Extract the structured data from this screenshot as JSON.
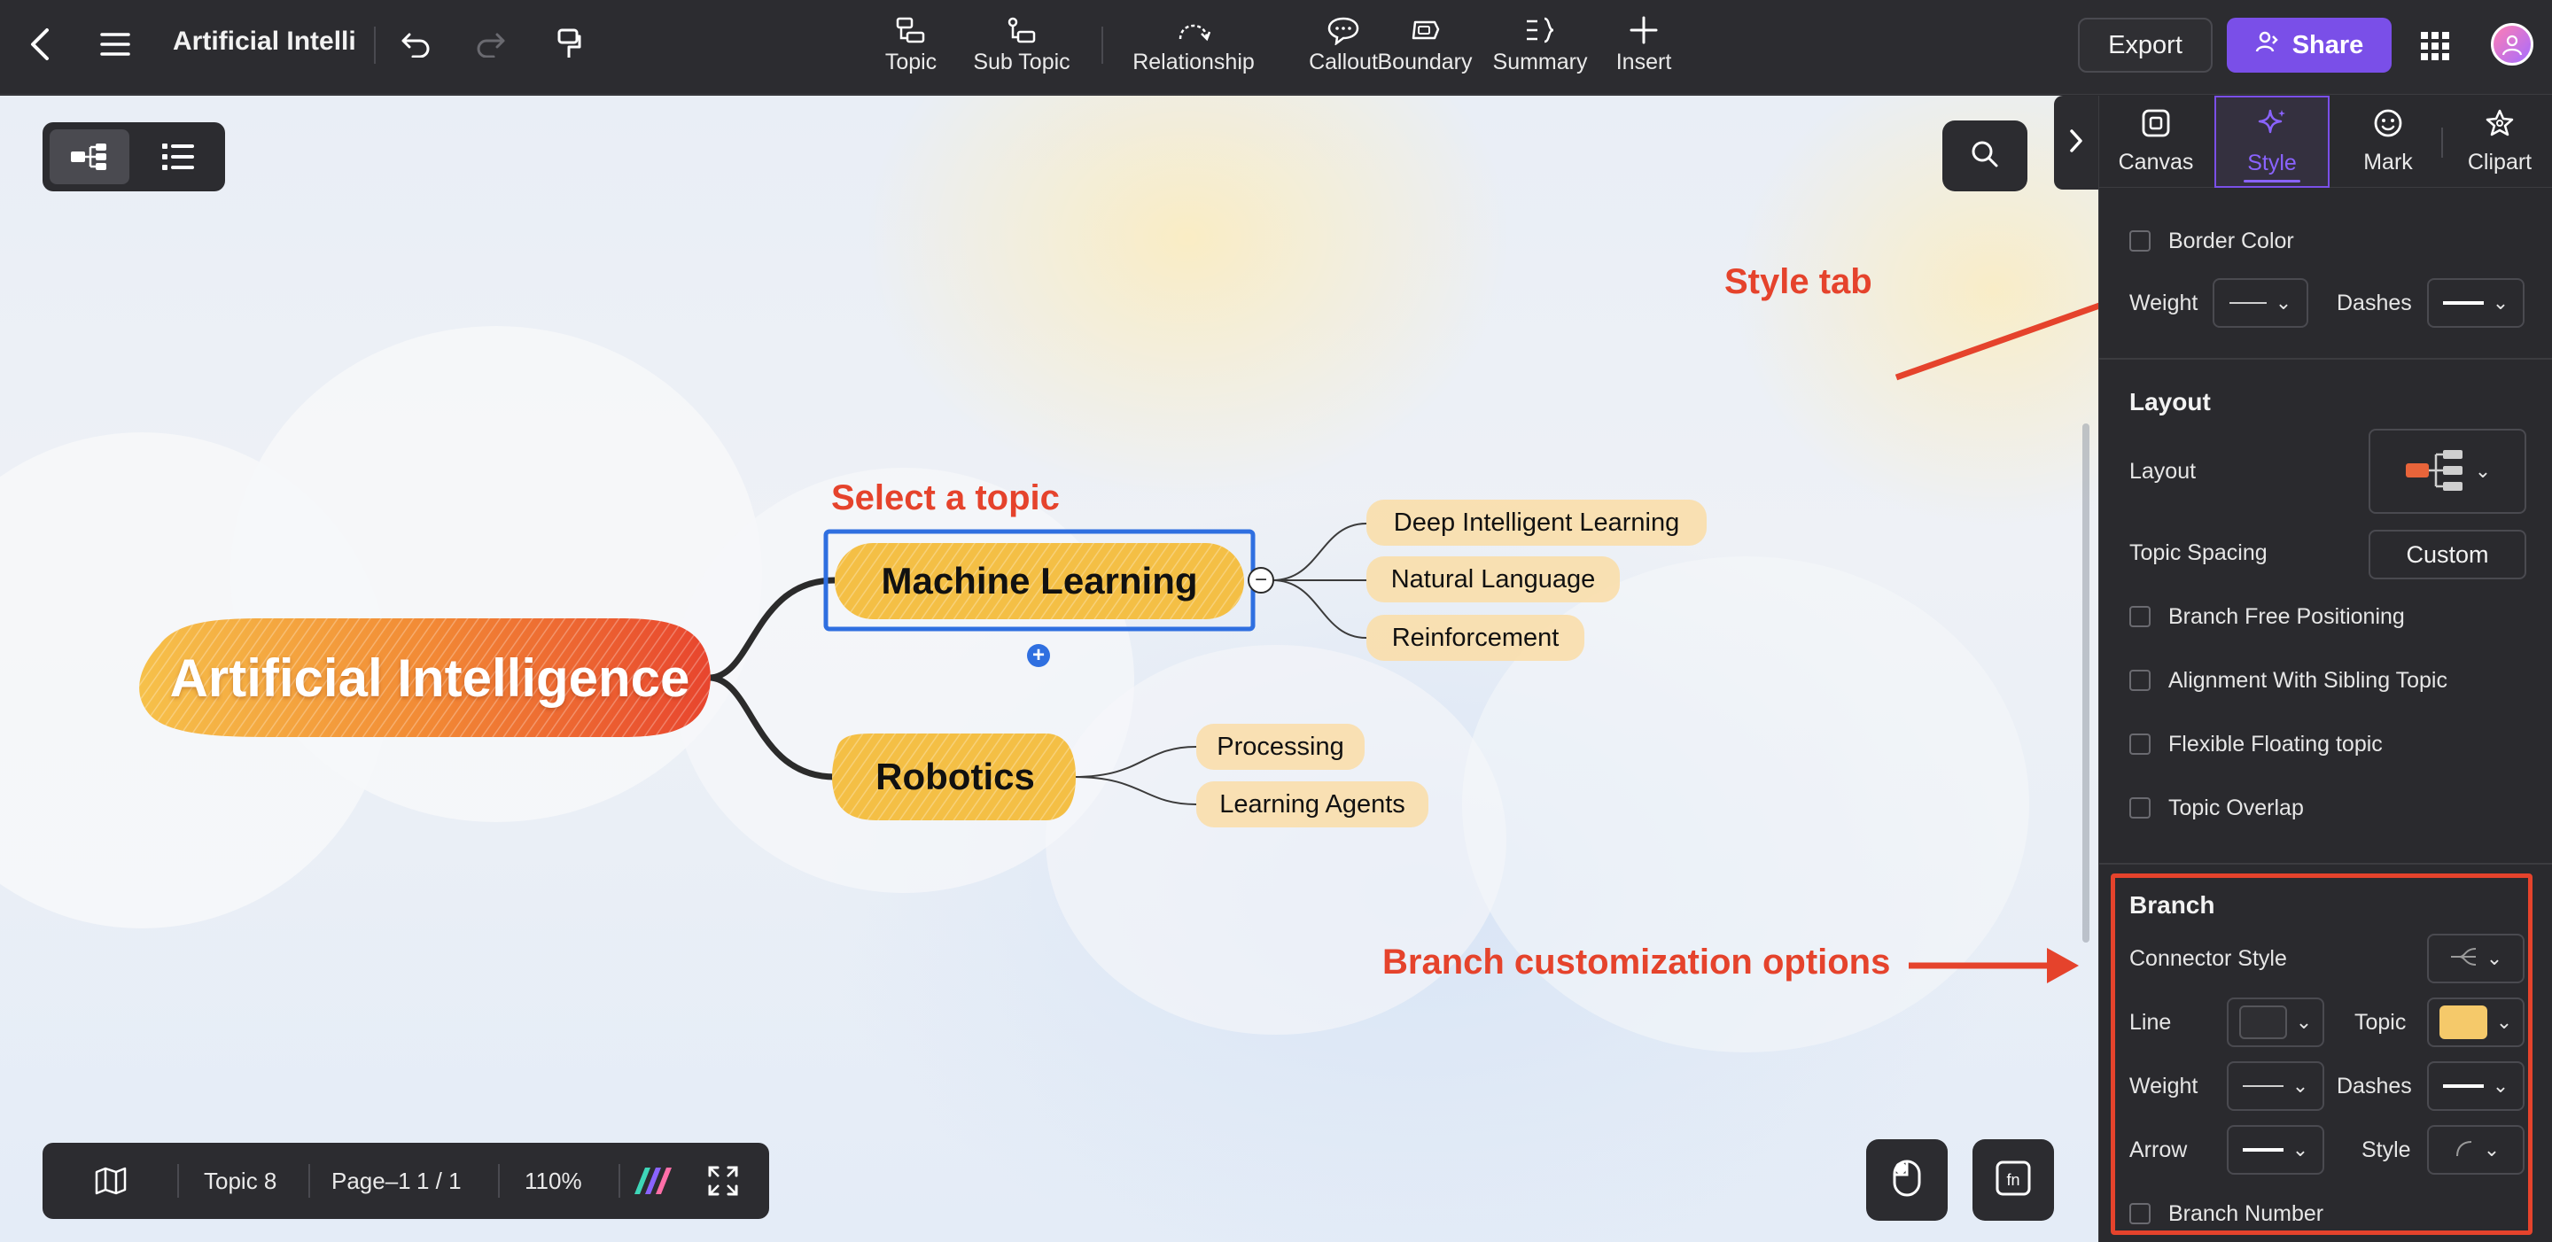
{
  "app": {
    "doc_title": "Artificial Intelli",
    "tools": [
      {
        "label": "Topic",
        "icon": "topic-icon"
      },
      {
        "label": "Sub Topic",
        "icon": "subtopic-icon"
      },
      {
        "label": "Relationship",
        "icon": "relationship-icon"
      },
      {
        "label": "Callout",
        "icon": "callout-icon"
      },
      {
        "label": "Boundary",
        "icon": "boundary-icon"
      },
      {
        "label": "Summary",
        "icon": "summary-icon"
      },
      {
        "label": "Insert",
        "icon": "plus-icon"
      }
    ],
    "export_label": "Export",
    "share_label": "Share"
  },
  "mindmap": {
    "root": "Artificial Intelligence",
    "branches": [
      {
        "label": "Machine Learning",
        "selected": true,
        "children": [
          "Deep Intelligent Learning",
          "Natural Language",
          "Reinforcement"
        ]
      },
      {
        "label": "Robotics",
        "selected": false,
        "children": [
          "Processing",
          "Learning Agents"
        ]
      }
    ],
    "collapse_glyph": "−",
    "add_glyph": "+"
  },
  "annotations": {
    "select_topic": "Select a topic",
    "style_tab": "Style tab",
    "branch_options": "Branch customization options"
  },
  "bottom_bar": {
    "topic_count": "Topic 8",
    "page_name": "Page–1",
    "page_index": "1 / 1",
    "zoom": "110%"
  },
  "panel": {
    "tabs": [
      {
        "label": "Canvas",
        "icon": "canvas-icon",
        "active": false
      },
      {
        "label": "Style",
        "icon": "sparkle-icon",
        "active": true
      },
      {
        "label": "Mark",
        "icon": "smiley-icon",
        "active": false
      },
      {
        "label": "Clipart",
        "icon": "clipart-icon",
        "active": false
      }
    ],
    "border": {
      "border_color_label": "Border Color",
      "weight_label": "Weight",
      "dashes_label": "Dashes"
    },
    "layout": {
      "title": "Layout",
      "layout_label": "Layout",
      "topic_spacing_label": "Topic Spacing",
      "topic_spacing_value": "Custom",
      "options": [
        "Branch Free Positioning",
        "Alignment With Sibling Topic",
        "Flexible Floating topic",
        "Topic Overlap"
      ]
    },
    "branch": {
      "title": "Branch",
      "connector_style_label": "Connector Style",
      "line_label": "Line",
      "topic_label": "Topic",
      "weight_label": "Weight",
      "dashes_label": "Dashes",
      "arrow_label": "Arrow",
      "style_label": "Style",
      "branch_number_label": "Branch Number",
      "line_color": "#2f2f33",
      "topic_color": "#f5c96a"
    }
  },
  "colors": {
    "accent": "#7a4fe8",
    "annotation_red": "#e5432c",
    "topic_yellow": "#f4bf45",
    "subtopic_fill": "#f9deab",
    "selection_blue": "#2f6fe0"
  }
}
